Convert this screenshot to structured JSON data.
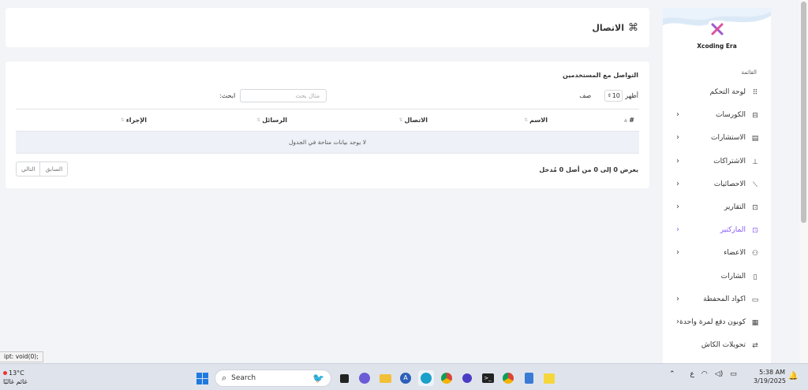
{
  "page": {
    "title": "الاتصال",
    "title_icon": "⌘"
  },
  "table_card": {
    "title": "التواصل مع المستخدمين",
    "show_label": "أظهر",
    "show_value": "10",
    "show_suffix": "صف",
    "search_label": "ابحث:",
    "search_placeholder": "مثال بحث",
    "columns": [
      "#",
      "الاسم",
      "الاتصال",
      "الرسائل",
      "الإجراء"
    ],
    "empty_message": "لا يوجد بيانات متاحة في الجدول",
    "info": "يعرض 0 إلى 0 من أصل 0 مُدخل",
    "prev_label": "السابق",
    "next_label": "التالي"
  },
  "sidebar": {
    "brand": "Xcoding Era",
    "menu_heading": "القائمة",
    "items": [
      {
        "label": "لوحة التحكم",
        "icon": "grid-icon",
        "has_children": false,
        "active": false
      },
      {
        "label": "الكورسات",
        "icon": "basket-icon",
        "has_children": true,
        "active": false
      },
      {
        "label": "الاستشارات",
        "icon": "document-icon",
        "has_children": true,
        "active": false
      },
      {
        "label": "الاشتراكات",
        "icon": "sitemap-icon",
        "has_children": true,
        "active": false
      },
      {
        "label": "الاحصائيات",
        "icon": "trend-icon",
        "has_children": true,
        "active": false
      },
      {
        "label": "التقارير",
        "icon": "archive-icon",
        "has_children": true,
        "active": false
      },
      {
        "label": "الماركتير",
        "icon": "archive-icon",
        "has_children": true,
        "active": true
      },
      {
        "label": "الاعضاء",
        "icon": "users-icon",
        "has_children": true,
        "active": false
      },
      {
        "label": "الشارات",
        "icon": "badge-icon",
        "has_children": false,
        "active": false
      },
      {
        "label": "اكواد المحفظة",
        "icon": "wallet-icon",
        "has_children": true,
        "active": false
      },
      {
        "label": "كوبون دفع لمرة واحدة",
        "icon": "ticket-icon",
        "has_children": true,
        "active": false
      },
      {
        "label": "تحويلات الكاش",
        "icon": "transfer-icon",
        "has_children": false,
        "active": false
      }
    ]
  },
  "status_bar": {
    "link_preview": "ipt: void(0);"
  },
  "taskbar": {
    "weather_temp": "13°C",
    "weather_desc": "غائم غالبًا",
    "search_label": "Search",
    "lang": "ع",
    "time": "5:38 AM",
    "date": "3/19/2025"
  },
  "colors": {
    "accent": "#8b5cf6",
    "page_bg": "#f3f4f7",
    "empty_row_bg": "#eef1f8"
  }
}
